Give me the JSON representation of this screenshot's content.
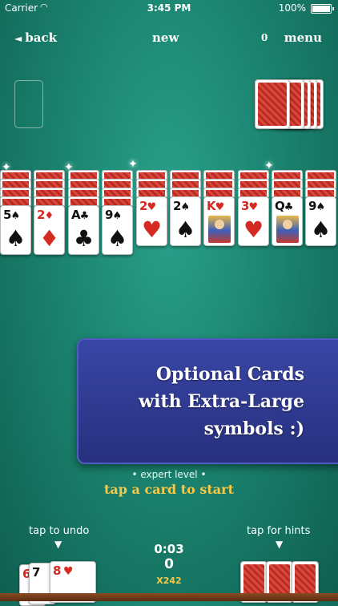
{
  "status_bar": {
    "carrier": "Carrier",
    "time": "3:45 PM",
    "battery": "100%"
  },
  "topbar": {
    "back_arrow": "◄",
    "back_label": "back",
    "new_label": "new",
    "score": "0",
    "menu_label": "menu"
  },
  "tableau": [
    {
      "rank": "5",
      "suit": "♠",
      "color": "black"
    },
    {
      "rank": "2",
      "suit": "♦",
      "color": "red"
    },
    {
      "rank": "A",
      "suit": "♣",
      "color": "black"
    },
    {
      "rank": "9",
      "suit": "♠",
      "color": "black"
    },
    {
      "rank": "2",
      "suit": "♥",
      "color": "red"
    },
    {
      "rank": "2",
      "suit": "♠",
      "color": "black"
    },
    {
      "rank": "K",
      "suit": "♥",
      "color": "red"
    },
    {
      "rank": "3",
      "suit": "♥",
      "color": "red"
    },
    {
      "rank": "Q",
      "suit": "♣",
      "color": "black"
    },
    {
      "rank": "9",
      "suit": "♠",
      "color": "black"
    }
  ],
  "promo": {
    "line1": "Optional Cards",
    "line2": "with Extra-Large",
    "line3": "symbols :)"
  },
  "level_label": "• expert level •",
  "start_label": "tap a card to start",
  "undo_label": "tap to undo",
  "hints_label": "tap for hints",
  "undo_cards": [
    {
      "rank": "6",
      "suit": "",
      "color": "red"
    },
    {
      "rank": "7",
      "suit": "",
      "color": "black"
    },
    {
      "rank": "8",
      "suit": "♥",
      "color": "red"
    }
  ],
  "stats": {
    "timer": "0:03",
    "moves": "0",
    "multiplier": "X242"
  },
  "arrow_down": "▼"
}
